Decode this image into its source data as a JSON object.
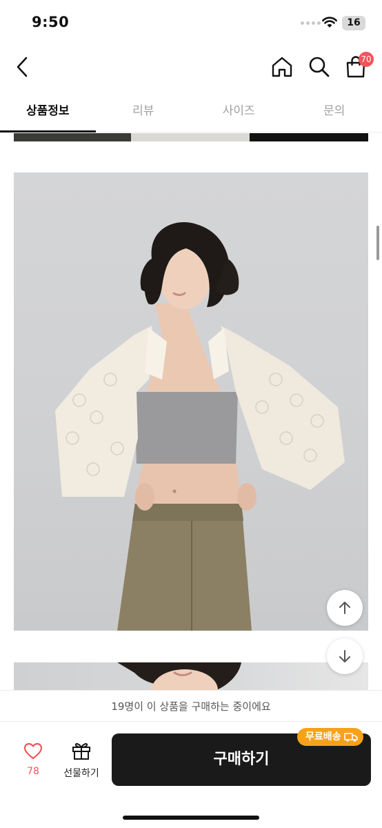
{
  "status_bar": {
    "time": "9:50",
    "battery": "16"
  },
  "header": {
    "cart_count": "70"
  },
  "tabs": [
    {
      "label": "상품정보",
      "active": true
    },
    {
      "label": "리뷰",
      "active": false
    },
    {
      "label": "사이즈",
      "active": false
    },
    {
      "label": "문의",
      "active": false
    }
  ],
  "notice": {
    "text": "19명이 이 상품을 구매하는 중이에요"
  },
  "bottom": {
    "like_count": "78",
    "gift_label": "선물하기",
    "buy_label": "구매하기",
    "free_shipping_label": "무료배송"
  },
  "colors": {
    "accent_red": "#f2545b",
    "free_shipping_orange": "#f7a11b",
    "buy_button": "#1a1a1a"
  },
  "icons": [
    "back-icon",
    "home-icon",
    "search-icon",
    "cart-icon",
    "heart-icon",
    "gift-icon",
    "truck-icon",
    "arrow-up-icon",
    "arrow-down-icon",
    "wifi-icon"
  ]
}
